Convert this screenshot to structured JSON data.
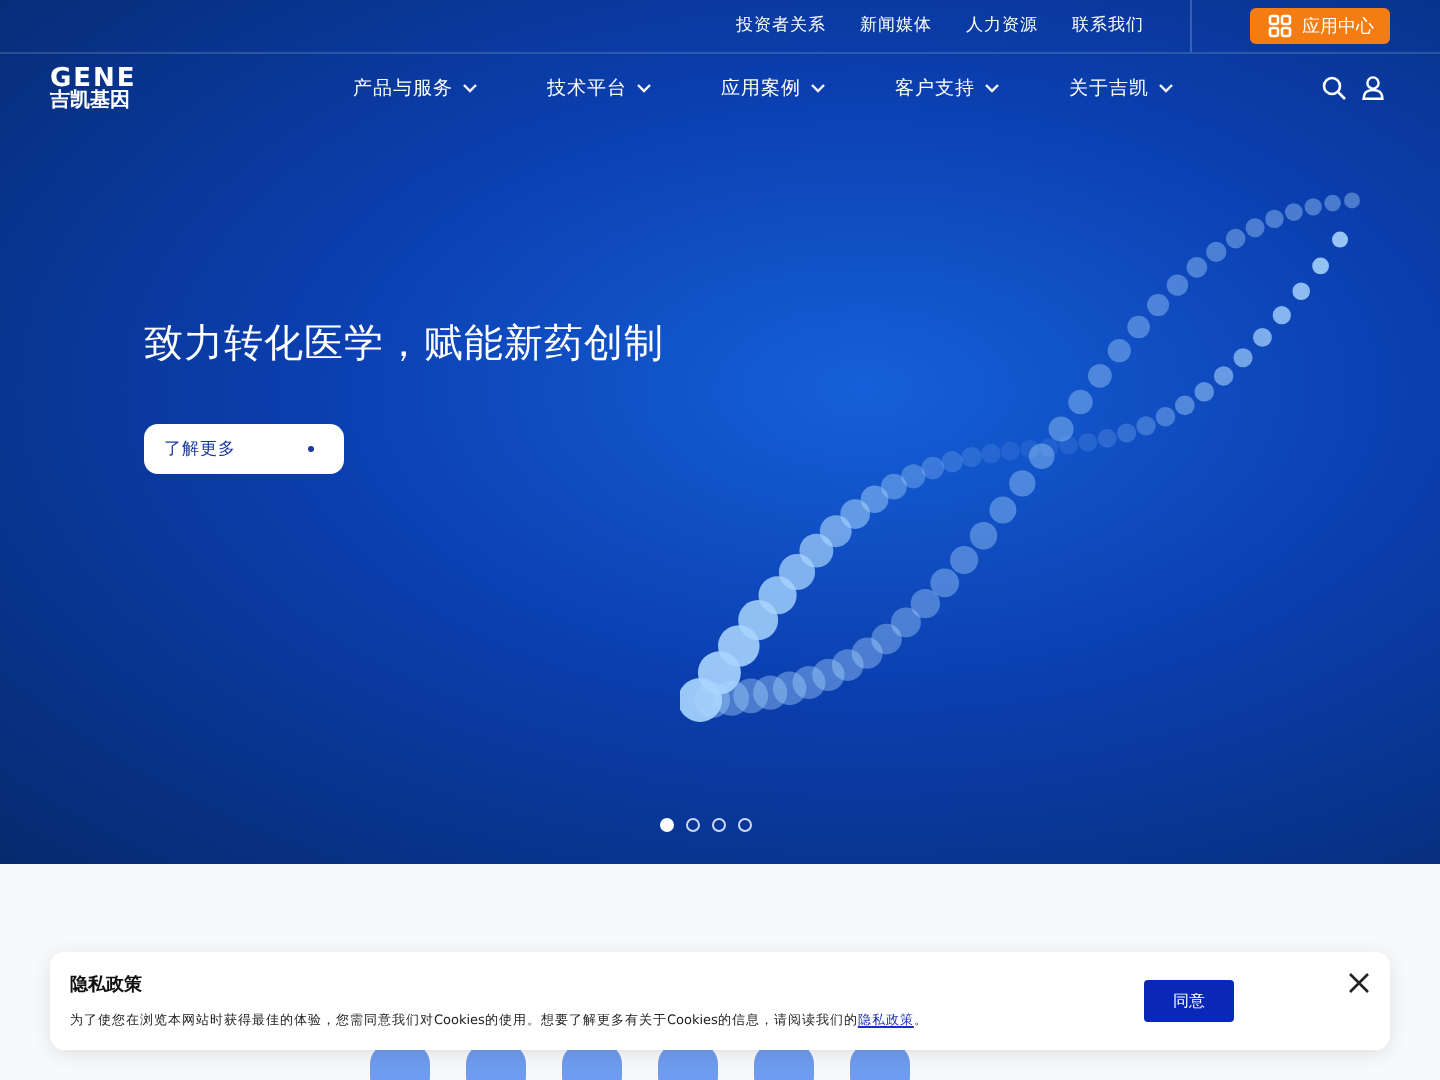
{
  "top_links": [
    "投资者关系",
    "新闻媒体",
    "人力资源",
    "联系我们"
  ],
  "app_center_button": "应用中心",
  "logo": {
    "latin": "GENE",
    "chinese": "吉凯基因"
  },
  "nav": [
    {
      "label": "产品与服务"
    },
    {
      "label": "技术平台"
    },
    {
      "label": "应用案例"
    },
    {
      "label": "客户支持"
    },
    {
      "label": "关于吉凯"
    }
  ],
  "hero": {
    "headline": "致力转化医学，赋能新药创制",
    "button": "了解更多"
  },
  "slides": [
    {
      "selected": true
    },
    {
      "selected": false
    },
    {
      "selected": false
    },
    {
      "selected": false
    }
  ],
  "cookie_banner": {
    "title": "隐私政策",
    "text": "为了使您在浏览本网站时获得最佳的体验，您需同意我们对Cookies的使用。想要了解更多有关于Cookies的信息，请阅读我们的",
    "link": "隐私政策",
    "end": "。",
    "accept_button": "同意"
  }
}
